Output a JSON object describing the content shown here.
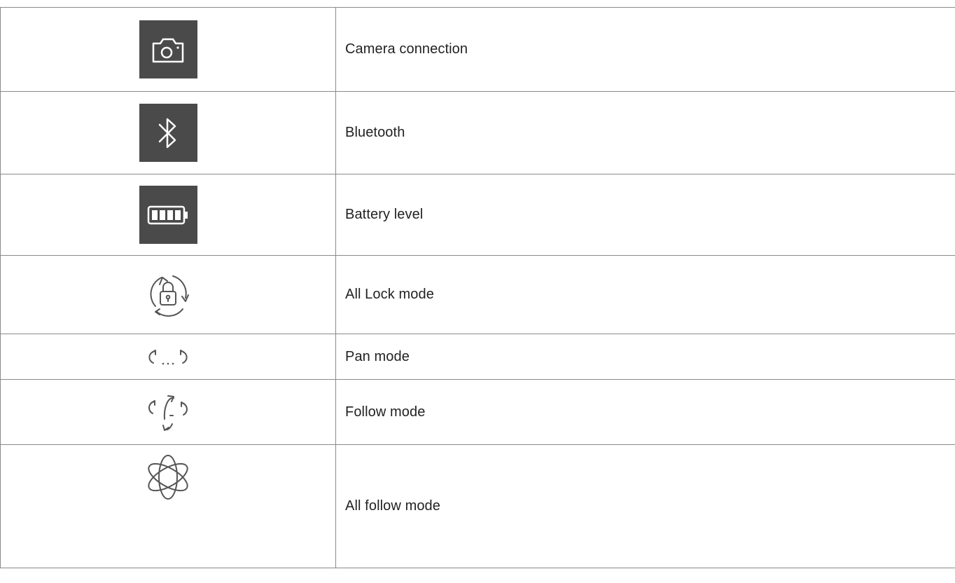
{
  "rows": [
    {
      "icon": "camera-icon",
      "label": "Camera connection"
    },
    {
      "icon": "bluetooth-icon",
      "label": "Bluetooth"
    },
    {
      "icon": "battery-icon",
      "label": "Battery level"
    },
    {
      "icon": "all-lock-mode-icon",
      "label": "All Lock mode"
    },
    {
      "icon": "pan-mode-icon",
      "label": "Pan mode"
    },
    {
      "icon": "follow-mode-icon",
      "label": "Follow mode"
    },
    {
      "icon": "all-follow-mode-icon",
      "label": "All follow mode"
    }
  ],
  "colors": {
    "icon_background": "#4a4a4a",
    "icon_stroke_light": "#ffffff",
    "icon_stroke_dark": "#555555",
    "border": "#8a8a8a"
  }
}
